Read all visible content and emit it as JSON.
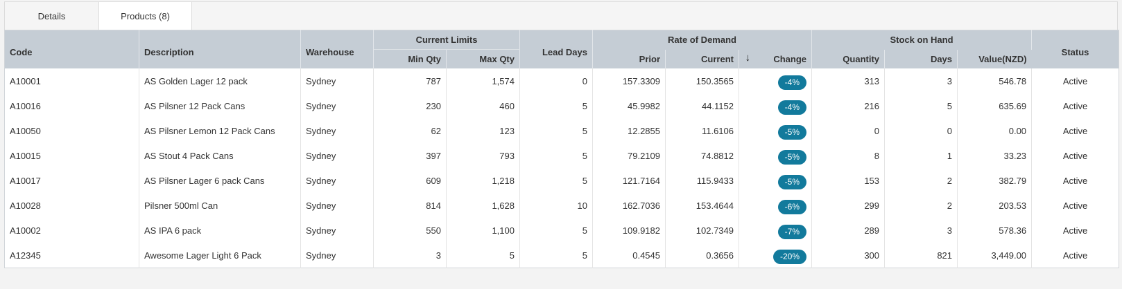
{
  "tabs": [
    {
      "label": "Details",
      "active": false
    },
    {
      "label": "Products (8)",
      "active": true
    }
  ],
  "headers": {
    "code": "Code",
    "description": "Description",
    "warehouse": "Warehouse",
    "current_limits": "Current Limits",
    "min_qty": "Min Qty",
    "max_qty": "Max Qty",
    "lead_days": "Lead Days",
    "rate_of_demand": "Rate of Demand",
    "prior": "Prior",
    "current": "Current",
    "change": "Change",
    "stock_on_hand": "Stock on Hand",
    "quantity": "Quantity",
    "days": "Days",
    "value": "Value(NZD)",
    "status": "Status",
    "sort_icon": "arrow-down-icon"
  },
  "colors": {
    "header_bg": "#c5cdd5",
    "change_pill": "#127a9c"
  },
  "rows": [
    {
      "code": "A10001",
      "description": "AS Golden Lager 12 pack",
      "warehouse": "Sydney",
      "min_qty": "787",
      "max_qty": "1,574",
      "lead_days": "0",
      "prior": "157.3309",
      "current": "150.3565",
      "change": "-4%",
      "quantity": "313",
      "days": "3",
      "value": "546.78",
      "status": "Active"
    },
    {
      "code": "A10016",
      "description": "AS Pilsner 12 Pack Cans",
      "warehouse": "Sydney",
      "min_qty": "230",
      "max_qty": "460",
      "lead_days": "5",
      "prior": "45.9982",
      "current": "44.1152",
      "change": "-4%",
      "quantity": "216",
      "days": "5",
      "value": "635.69",
      "status": "Active"
    },
    {
      "code": "A10050",
      "description": "AS Pilsner Lemon 12 Pack Cans",
      "warehouse": "Sydney",
      "min_qty": "62",
      "max_qty": "123",
      "lead_days": "5",
      "prior": "12.2855",
      "current": "11.6106",
      "change": "-5%",
      "quantity": "0",
      "days": "0",
      "value": "0.00",
      "status": "Active"
    },
    {
      "code": "A10015",
      "description": "AS Stout 4 Pack Cans",
      "warehouse": "Sydney",
      "min_qty": "397",
      "max_qty": "793",
      "lead_days": "5",
      "prior": "79.2109",
      "current": "74.8812",
      "change": "-5%",
      "quantity": "8",
      "days": "1",
      "value": "33.23",
      "status": "Active"
    },
    {
      "code": "A10017",
      "description": "AS Pilsner Lager 6 pack Cans",
      "warehouse": "Sydney",
      "min_qty": "609",
      "max_qty": "1,218",
      "lead_days": "5",
      "prior": "121.7164",
      "current": "115.9433",
      "change": "-5%",
      "quantity": "153",
      "days": "2",
      "value": "382.79",
      "status": "Active"
    },
    {
      "code": "A10028",
      "description": "Pilsner 500ml Can",
      "warehouse": "Sydney",
      "min_qty": "814",
      "max_qty": "1,628",
      "lead_days": "10",
      "prior": "162.7036",
      "current": "153.4644",
      "change": "-6%",
      "quantity": "299",
      "days": "2",
      "value": "203.53",
      "status": "Active"
    },
    {
      "code": "A10002",
      "description": "AS IPA 6 pack",
      "warehouse": "Sydney",
      "min_qty": "550",
      "max_qty": "1,100",
      "lead_days": "5",
      "prior": "109.9182",
      "current": "102.7349",
      "change": "-7%",
      "quantity": "289",
      "days": "3",
      "value": "578.36",
      "status": "Active"
    },
    {
      "code": "A12345",
      "description": "Awesome Lager Light 6 Pack",
      "warehouse": "Sydney",
      "min_qty": "3",
      "max_qty": "5",
      "lead_days": "5",
      "prior": "0.4545",
      "current": "0.3656",
      "change": "-20%",
      "quantity": "300",
      "days": "821",
      "value": "3,449.00",
      "status": "Active"
    }
  ]
}
